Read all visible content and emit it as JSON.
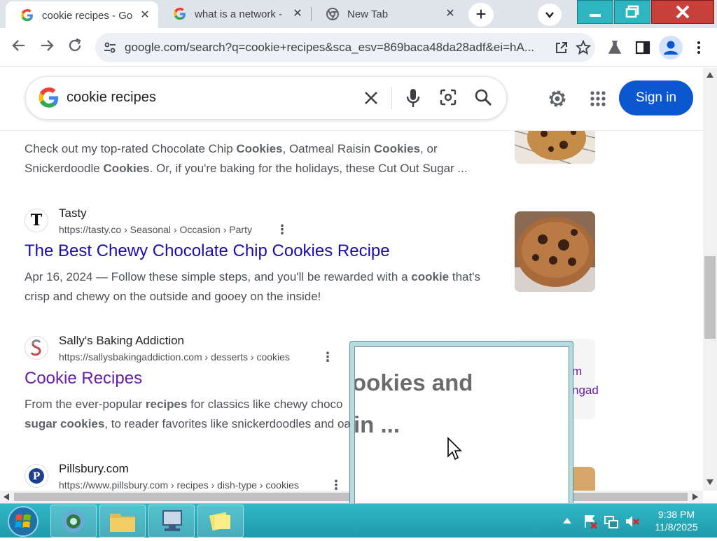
{
  "browser": {
    "tabs": [
      {
        "label": "cookie recipes - Go",
        "icon": "google-g-icon",
        "active": true
      },
      {
        "label": "what is a network -",
        "icon": "google-g-icon",
        "active": false
      },
      {
        "label": "New Tab",
        "icon": "chrome-icon",
        "active": false
      }
    ],
    "close_glyph": "✕",
    "new_tab_glyph": "+",
    "address": "google.com/search?q=cookie+recipes&sca_esv=869baca48da28adf&ei=hA..."
  },
  "search": {
    "query": "cookie recipes",
    "sign_in_label": "Sign in"
  },
  "results": {
    "top_snippet_html": "Check out my top-rated Chocolate Chip <b>Cookies</b>, Oatmeal Raisin <b>Cookies</b>, or Snickerdoodle <b>Cookies</b>. Or, if you're baking for the holidays, these Cut Out Sugar ...",
    "items": [
      {
        "site": "Tasty",
        "url": "https://tasty.co › Seasonal › Occasion › Party",
        "title": "The Best Chewy Chocolate Chip Cookies Recipe",
        "snippet_html": "Apr 16, 2024 — Follow these simple steps, and you'll be rewarded with a <b>cookie</b> that's crisp and chewy on the outside and gooey on the inside!"
      },
      {
        "site": "Sally's Baking Addiction",
        "url": "https://sallysbakingaddiction.com › desserts › cookies",
        "title": "Cookie Recipes",
        "snippet_html": "From the ever-popular <b>recipes</b> for classics like chewy choco<br><b>sugar cookies</b>, to reader favorites like snickerdoodles and oa"
      },
      {
        "site": "Pillsbury.com",
        "url": "https://www.pillsbury.com › recipes › dish-type › cookies",
        "title": "",
        "snippet_html": ""
      }
    ],
    "partial_right_text": [
      "m",
      "ngad"
    ]
  },
  "magnifier": {
    "line1": "ookies and",
    "line2": "in ..."
  },
  "taskbar": {
    "time": "9:38 PM",
    "date": "11/8/2025"
  },
  "colors": {
    "link": "#1a0dab",
    "visited": "#681da8",
    "sign_in_bg": "#0b57d0",
    "taskbar": "#1f9aab"
  }
}
